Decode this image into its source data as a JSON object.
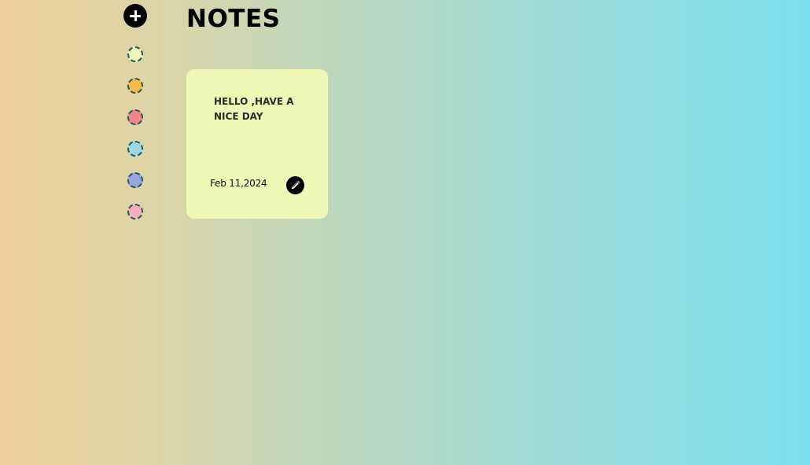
{
  "app": {
    "title": "NOTES"
  },
  "sidebar": {
    "add_icon": "plus-icon",
    "swatches": [
      {
        "name": "light-yellow",
        "color": "#eff7b4"
      },
      {
        "name": "orange",
        "color": "#f5b94f"
      },
      {
        "name": "red",
        "color": "#f08587"
      },
      {
        "name": "light-blue",
        "color": "#a0d8e0"
      },
      {
        "name": "purple",
        "color": "#9aa4de"
      },
      {
        "name": "pink",
        "color": "#f5aebc"
      }
    ]
  },
  "notes": [
    {
      "text": "HELLO ,HAVE A NICE DAY",
      "date": "Feb 11,2024",
      "color": "#eff7b4",
      "edit_icon": "pencil-icon"
    }
  ]
}
